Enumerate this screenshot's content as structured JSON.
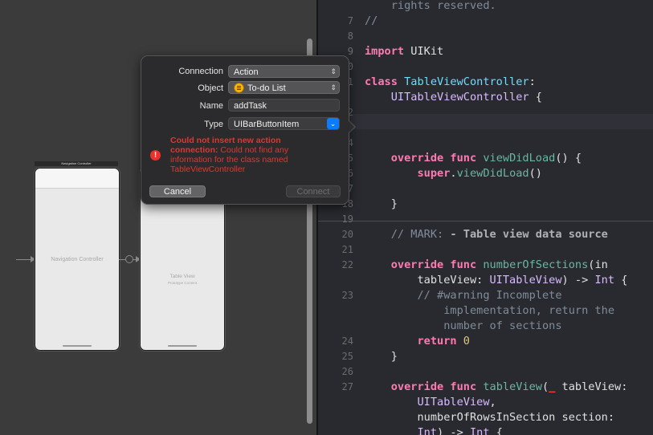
{
  "storyboard": {
    "navigation_controller": {
      "scene_title": "Navigation Controller",
      "label": "Navigation Controller"
    },
    "table_view_controller": {
      "label": "Table View",
      "sublabel": "Prototype Content"
    }
  },
  "popover": {
    "connection": {
      "label": "Connection",
      "value": "Action"
    },
    "object": {
      "label": "Object",
      "value": "To-do List"
    },
    "name": {
      "label": "Name",
      "value": "addTask"
    },
    "type": {
      "label": "Type",
      "value": "UIBarButtonItem"
    },
    "error": {
      "title": "Could not insert new action connection:",
      "detail": "Could not find any information for the class named TableViewController"
    },
    "cancel_label": "Cancel",
    "connect_label": "Connect"
  },
  "editor": {
    "lines": [
      {
        "num": "",
        "tokens": [
          [
            "cm",
            "    rights reserved."
          ]
        ]
      },
      {
        "num": "7",
        "tokens": [
          [
            "cm",
            "//"
          ]
        ]
      },
      {
        "num": "8",
        "tokens": []
      },
      {
        "num": "9",
        "tokens": [
          [
            "kw",
            "import"
          ],
          [
            "",
            " UIKit"
          ]
        ]
      },
      {
        "num": "10",
        "tokens": []
      },
      {
        "num": "11",
        "tokens": [
          [
            "kw",
            "class"
          ],
          [
            "",
            " "
          ],
          [
            "ty",
            "TableViewController"
          ],
          [
            "",
            ":"
          ]
        ]
      },
      {
        "num": "",
        "tokens": [
          [
            "typ",
            "    UITableViewController"
          ],
          [
            "",
            " {"
          ]
        ]
      },
      {
        "num": "12",
        "tokens": []
      },
      {
        "num": "13",
        "tokens": []
      },
      {
        "num": "14",
        "tokens": []
      },
      {
        "num": "15",
        "tokens": [
          [
            "kw",
            "    override func"
          ],
          [
            "",
            " "
          ],
          [
            "fn",
            "viewDidLoad"
          ],
          [
            "",
            "() {"
          ]
        ]
      },
      {
        "num": "16",
        "tokens": [
          [
            "kw",
            "        super"
          ],
          [
            "",
            "."
          ],
          [
            "fn",
            "viewDidLoad"
          ],
          [
            "",
            "()"
          ]
        ]
      },
      {
        "num": "17",
        "tokens": []
      },
      {
        "num": "18",
        "tokens": [
          [
            "",
            "    }"
          ]
        ]
      },
      {
        "num": "19",
        "tokens": []
      },
      {
        "num": "20",
        "tokens": [
          [
            "cm",
            "    // MARK: "
          ],
          [
            "mark",
            "- Table view data source"
          ]
        ]
      },
      {
        "num": "21",
        "tokens": []
      },
      {
        "num": "22",
        "tokens": [
          [
            "kw",
            "    override func"
          ],
          [
            "",
            " "
          ],
          [
            "fn",
            "numberOfSections"
          ],
          [
            "",
            "(in"
          ]
        ]
      },
      {
        "num": "",
        "tokens": [
          [
            "",
            "        tableView: "
          ],
          [
            "typ",
            "UITableView"
          ],
          [
            "",
            ") -> "
          ],
          [
            "typ",
            "Int"
          ],
          [
            "",
            " {"
          ]
        ]
      },
      {
        "num": "23",
        "tokens": [
          [
            "cm",
            "        // #warning Incomplete"
          ]
        ]
      },
      {
        "num": "",
        "tokens": [
          [
            "cm",
            "            implementation, return the"
          ]
        ]
      },
      {
        "num": "",
        "tokens": [
          [
            "cm",
            "            number of sections"
          ]
        ]
      },
      {
        "num": "24",
        "tokens": [
          [
            "kw",
            "        return"
          ],
          [
            "",
            " "
          ],
          [
            "num",
            "0"
          ]
        ]
      },
      {
        "num": "25",
        "tokens": [
          [
            "",
            "    }"
          ]
        ]
      },
      {
        "num": "26",
        "tokens": []
      },
      {
        "num": "27",
        "tokens": [
          [
            "kw",
            "    override func"
          ],
          [
            "",
            " "
          ],
          [
            "fn",
            "tableView"
          ],
          [
            "",
            "("
          ],
          [
            "err",
            "_"
          ],
          [
            "",
            " tableView:"
          ]
        ]
      },
      {
        "num": "",
        "tokens": [
          [
            "typ",
            "        UITableView"
          ],
          [
            "",
            ","
          ]
        ]
      },
      {
        "num": "",
        "tokens": [
          [
            "",
            "        numberOfRowsInSection section:"
          ]
        ]
      },
      {
        "num": "",
        "tokens": [
          [
            "typ",
            "        Int"
          ],
          [
            "",
            ") -> "
          ],
          [
            "typ",
            "Int"
          ],
          [
            "",
            " {"
          ]
        ]
      }
    ]
  },
  "colors": {
    "accent": "#0a7cff",
    "error": "#e3352e",
    "keyword": "#ff7ab2",
    "type_decl": "#6bdfff",
    "type_ref": "#dabaff",
    "comment": "#7f8c98"
  }
}
